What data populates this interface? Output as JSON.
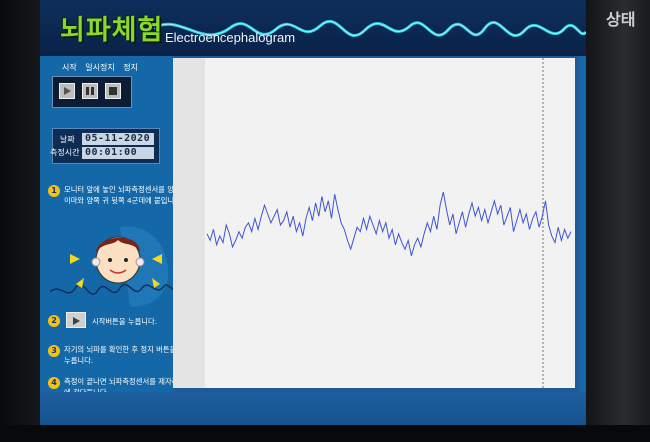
{
  "app": {
    "title_ko": "뇌파체험",
    "title_en": "Electroencephalogram"
  },
  "controls": {
    "start_label": "시작",
    "pause_label": "일시정지",
    "stop_label": "정지"
  },
  "measurement": {
    "date_label": "날짜",
    "date_value": "05-11-2020",
    "time_label": "측정시간",
    "time_value": "00:01:00"
  },
  "steps": [
    {
      "num": "1",
      "text": "모니터 앞에 놓인 뇌파측정센서를 양쪽 이마와 양쪽 귀 뒷쪽 4군데에 붙입니다."
    },
    {
      "num": "2",
      "text": "시작버튼을 누릅니다."
    },
    {
      "num": "3",
      "text": "자기의 뇌파를 확인한 후 정지 버튼을 누릅니다."
    },
    {
      "num": "4",
      "text": "측정이 끝나면 뇌파측정센서를 제자리에 갖다둡니다."
    }
  ],
  "bezel": {
    "ghost_text": "상태"
  },
  "colors": {
    "screen_bg": "#1568a8",
    "header_bg": "#0d2f5c",
    "wave_accent": "#2fe0f0",
    "title_green": "#8ad82e",
    "trace_blue": "#3f54d6",
    "step_badge": "#f2c21b"
  },
  "icons": {
    "start": "play-icon",
    "pause": "pause-icon",
    "stop": "stop-icon"
  },
  "chart_data": {
    "type": "line",
    "title": "",
    "xlabel": "",
    "ylabel": "",
    "grid": false,
    "series": [
      {
        "values": [
          0.1,
          -0.2,
          0.3,
          -0.4,
          0.0,
          -0.3,
          0.5,
          0.1,
          -0.5,
          -0.2,
          0.2,
          -0.1,
          0.4,
          0.6,
          0.2,
          0.8,
          0.3,
          0.9,
          1.4,
          1.0,
          0.6,
          0.9,
          1.2,
          0.5,
          0.7,
          1.1,
          0.4,
          0.9,
          0.2,
          0.6,
          0.0,
          0.8,
          1.3,
          0.7,
          1.5,
          0.9,
          1.8,
          1.1,
          1.6,
          0.8,
          1.9,
          1.2,
          0.6,
          0.3,
          -0.2,
          -0.6,
          -0.1,
          0.4,
          0.2,
          0.8,
          0.3,
          0.9,
          0.5,
          0.1,
          0.7,
          0.2,
          0.6,
          -0.1,
          0.3,
          -0.4,
          0.1,
          -0.3,
          -0.6,
          -0.2,
          -0.9,
          -0.4,
          -0.1,
          -0.5,
          0.1,
          0.6,
          0.2,
          0.9,
          0.3,
          1.4,
          2.0,
          1.2,
          0.5,
          1.0,
          0.1,
          0.6,
          1.1,
          0.4,
          1.0,
          1.5,
          0.9,
          1.3,
          0.7,
          1.2,
          0.6,
          1.1,
          1.6,
          1.0,
          1.4,
          0.5,
          0.9,
          1.3,
          0.2,
          0.7,
          1.2,
          0.6,
          1.0,
          0.3,
          0.8,
          1.1,
          0.4,
          0.9,
          1.6,
          0.5,
          0.0,
          -0.3,
          0.4,
          -0.2,
          0.3,
          -0.1,
          0.2
        ]
      }
    ]
  }
}
